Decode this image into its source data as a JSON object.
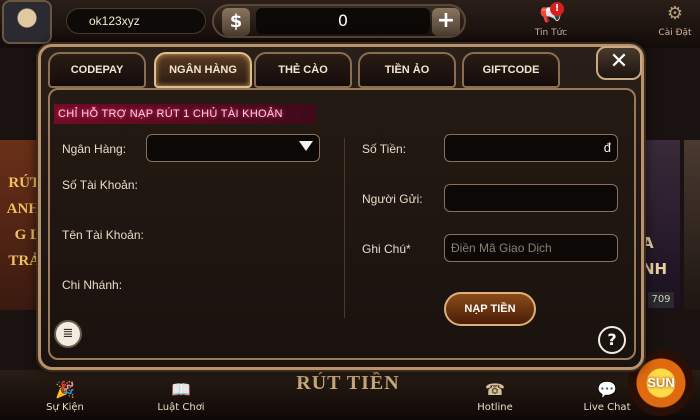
{
  "header": {
    "username": "ok123xyz",
    "balance": "0",
    "dollar_icon": "$",
    "plus_icon": "+",
    "news_label": "Tin Tức",
    "news_badge": "!",
    "settings_label": "Cài Đặt"
  },
  "background": {
    "left_banner": [
      "RÚT",
      "ANH",
      "G L",
      "TRẢ"
    ],
    "right_banner": [
      "A",
      "NH"
    ],
    "right_chip": "709"
  },
  "modal": {
    "tabs": [
      {
        "label": "CODEPAY",
        "active": false
      },
      {
        "label": "NGÂN HÀNG",
        "active": true
      },
      {
        "label": "THẺ CÀO",
        "active": false
      },
      {
        "label": "TIỀN ẢO",
        "active": false
      },
      {
        "label": "GIFTCODE",
        "active": false
      }
    ],
    "close_icon": "✕",
    "notice": "CHỈ HỖ TRỢ NẠP RÚT 1 CHỦ TÀI KHOẢN",
    "left": {
      "bank_label": "Ngân Hàng:",
      "bank_value": "",
      "account_number_label": "Số Tài Khoản:",
      "account_name_label": "Tên Tài Khoản:",
      "branch_label": "Chi Nhánh:"
    },
    "right": {
      "amount_label": "Số Tiền:",
      "amount_currency": "đ",
      "sender_label": "Người Gửi:",
      "note_label": "Ghi Chú*",
      "note_placeholder": "Điền Mã Giao Dịch"
    },
    "submit_label": "NẠP TIỀN",
    "history_icon": "≣",
    "help_icon": "?"
  },
  "footer": {
    "items": [
      {
        "label": "Sự Kiện",
        "icon": "🎉"
      },
      {
        "label": "Luật Chơi",
        "icon": "📖"
      },
      {
        "label": "Hotline",
        "icon": "☎"
      },
      {
        "label": "Live Chat",
        "icon": "💬"
      }
    ],
    "center_label": "RÚT TIỀN",
    "logo_text": "SUN"
  },
  "colors": {
    "frame_gold": "#b8926a",
    "notice_bg": "#780a28",
    "submit_bg": "#8a4a18"
  }
}
